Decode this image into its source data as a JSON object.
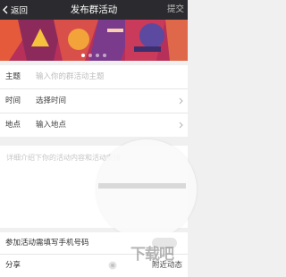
{
  "navbar": {
    "back_label": "返回",
    "title": "发布群活动",
    "submit_label": "提交"
  },
  "banner": {
    "dots_total": 4,
    "active_dot_index": 0
  },
  "form": {
    "theme": {
      "label": "主题",
      "placeholder": "输入你的群活动主题"
    },
    "time": {
      "label": "时间",
      "value": "选择时间"
    },
    "place": {
      "label": "地点",
      "value": "输入地点"
    }
  },
  "description": {
    "placeholder": "详细介绍下你的活动内容和活动安排"
  },
  "phone_option": {
    "label": "参加活动需填写手机号码",
    "enabled": false
  },
  "share": {
    "label": "分享",
    "nearby_label": "附近动态"
  },
  "watermark": {
    "text": "下载吧"
  }
}
